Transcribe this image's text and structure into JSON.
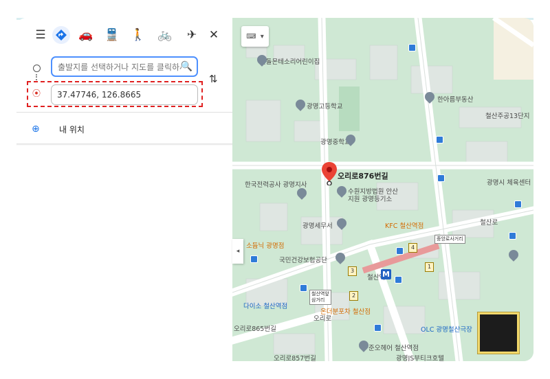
{
  "directions": {
    "from_placeholder": "출발지를 선택하거나 지도를 클릭하세",
    "to_value": "37.47746, 126.8665",
    "my_location": "내 위치"
  },
  "map": {
    "pin_label": "오리로876번길",
    "labels": [
      {
        "text": "흰돌몬테소리어린이집",
        "cls": ""
      },
      {
        "text": "광명고등학교",
        "cls": ""
      },
      {
        "text": "한아름부동산",
        "cls": ""
      },
      {
        "text": "철산주공13단지",
        "cls": ""
      },
      {
        "text": "광명중학교",
        "cls": ""
      },
      {
        "text": "한국전력공사 광명지사",
        "cls": ""
      },
      {
        "text": "수원지방법원 안산",
        "cls": ""
      },
      {
        "text": "지원 광명등기소",
        "cls": ""
      },
      {
        "text": "광명시 체육센터",
        "cls": ""
      },
      {
        "text": "광명세무서",
        "cls": ""
      },
      {
        "text": "KFC 철산역점",
        "cls": "orange"
      },
      {
        "text": "소듐닉 광명점",
        "cls": "orange"
      },
      {
        "text": "국민건강보험공단",
        "cls": ""
      },
      {
        "text": "다이소 철산역점",
        "cls": "blue"
      },
      {
        "text": "온더분포차 철산점",
        "cls": "orange"
      },
      {
        "text": "OLC 광명철산극장",
        "cls": "blue"
      },
      {
        "text": "준오헤어 철산역점",
        "cls": ""
      },
      {
        "text": "광명JS부티크호텔",
        "cls": ""
      },
      {
        "text": "철산로",
        "cls": ""
      },
      {
        "text": "오리로",
        "cls": ""
      },
      {
        "text": "오리로865번길",
        "cls": ""
      },
      {
        "text": "오리로857번길",
        "cls": ""
      },
      {
        "text": "철산역",
        "cls": ""
      },
      {
        "text": "중앙로사거리",
        "cls": ""
      },
      {
        "text": "철산역앞 삼거리",
        "cls": ""
      }
    ],
    "exits": [
      "1",
      "2",
      "3",
      "4"
    ],
    "metro_icon": "M",
    "logo_text": "노랑 노랑"
  }
}
